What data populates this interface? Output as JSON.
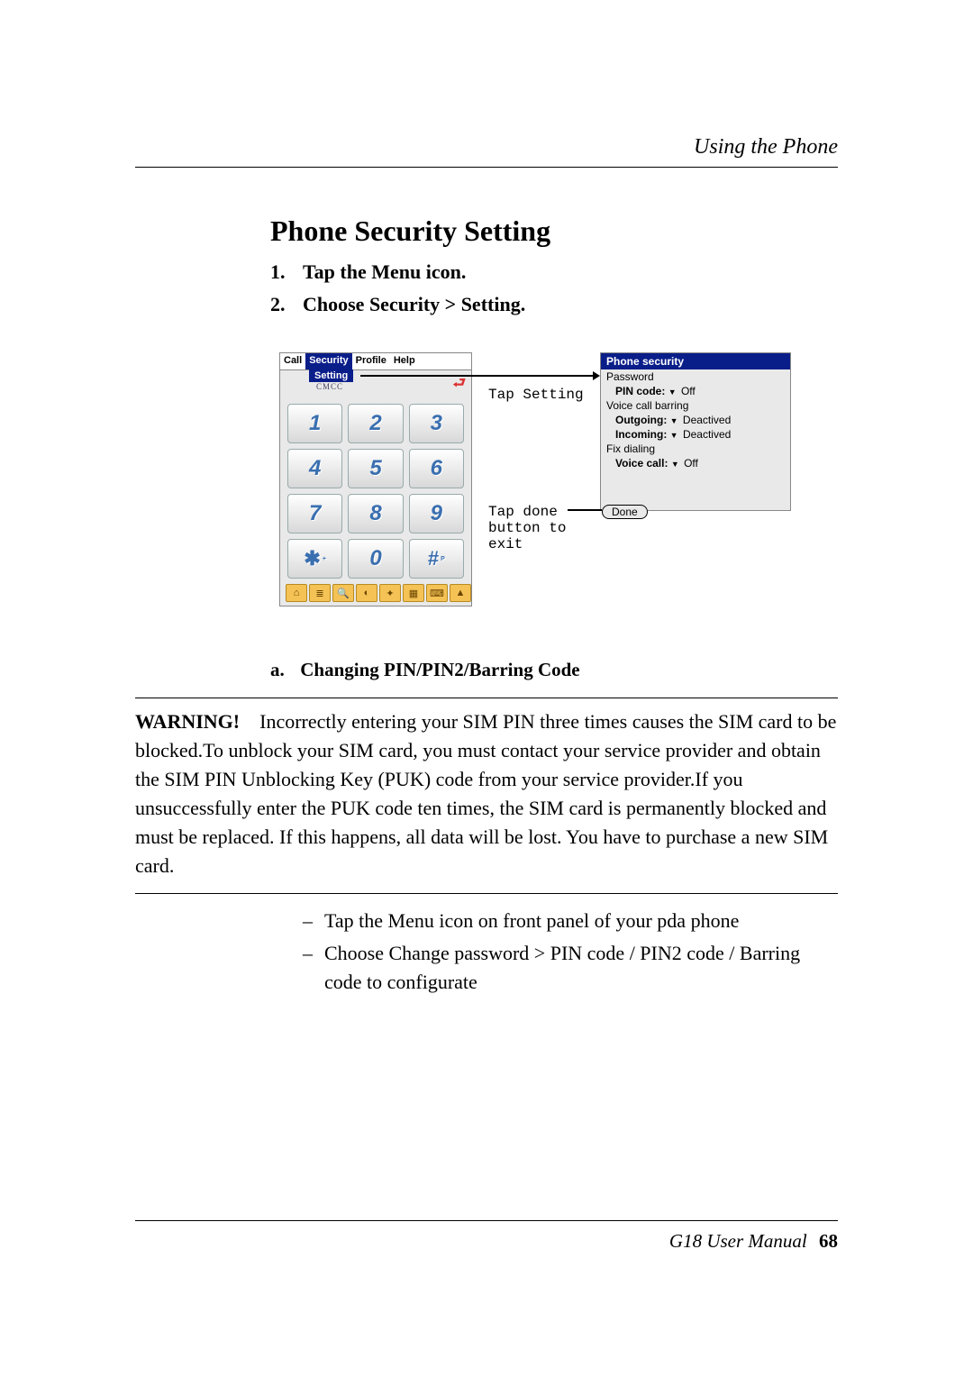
{
  "running_head": "Using the Phone",
  "heading": "Phone Security Setting",
  "steps": [
    {
      "num": "1.",
      "text": "Tap the Menu icon."
    },
    {
      "num": "2.",
      "text": "Choose Security > Setting."
    }
  ],
  "device": {
    "menubar": [
      "Call",
      "Security",
      "Profile",
      "Help"
    ],
    "selected_menu_index": 1,
    "submenu_label": "Setting",
    "signal_text": "CMCC",
    "keypad": [
      [
        "1",
        "2",
        "3"
      ],
      [
        "4",
        "5",
        "6"
      ],
      [
        "7",
        "8",
        "9"
      ],
      [
        "✱",
        "0",
        "#"
      ]
    ],
    "key_subs": {
      "star": "+",
      "hash": "P"
    },
    "iconbar_count": 8
  },
  "annotations": {
    "tap_setting": "Tap Setting",
    "tap_done": "Tap done button to exit"
  },
  "security_panel": {
    "title": "Phone security",
    "lines": [
      {
        "label": "Password",
        "bold": false
      },
      {
        "label": "PIN code:",
        "value": "Off",
        "bold": true,
        "indent": true,
        "dropdown": true
      },
      {
        "label": "Voice call barring",
        "bold": false
      },
      {
        "label": "Outgoing:",
        "value": "Deactived",
        "bold": true,
        "indent": true,
        "dropdown": true
      },
      {
        "label": "Incoming:",
        "value": "Deactived",
        "bold": true,
        "indent": true,
        "dropdown": true
      },
      {
        "label": "Fix dialing",
        "bold": false
      },
      {
        "label": "Voice call:",
        "value": "Off",
        "bold": true,
        "indent": true,
        "dropdown": true
      }
    ],
    "done_label": "Done"
  },
  "sub_heading": {
    "label": "a.",
    "text": "Changing PIN/PIN2/Barring Code"
  },
  "warning": {
    "label": "WARNING!",
    "text": "Incorrectly entering your SIM PIN three times causes the SIM card to be blocked.To unblock your SIM card, you must contact your service provider and obtain the SIM PIN Unblocking Key (PUK) code from your service provider.If you unsuccessfully enter the PUK code ten times, the SIM card is permanently blocked and must be replaced. If this happens, all data will be lost. You have to purchase a new SIM card."
  },
  "bullets": [
    "Tap the Menu icon on front panel of your pda phone",
    "Choose Change password > PIN code / PIN2 code / Barring code to configurate"
  ],
  "footer": {
    "manual": "G18 User Manual",
    "page": "68"
  }
}
